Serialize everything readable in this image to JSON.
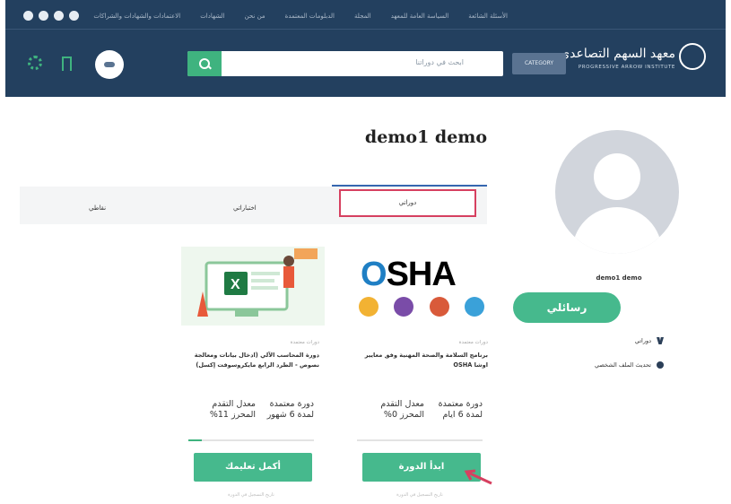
{
  "header": {
    "top_links": [
      "الأسئلة الشائعة",
      "السياسة العامة للمعهد",
      "المجلة",
      "الدبلومات المعتمدة",
      "من نحن",
      "الشهادات",
      "الاعتمادات والشهادات والشراكات"
    ],
    "logo_ar": "معهد السهم التصاعدي",
    "logo_en": "PROGRESSIVE ARROW INSTITUTE",
    "search_placeholder": "ابحث في دوراتنا",
    "category_label": "CATEGORY"
  },
  "profile": {
    "name": "demo1 demo",
    "side_name": "demo1 demo",
    "messages_button": "رسائلي",
    "side_links": [
      "دوراتي",
      "تحديث الملف الشخصي"
    ]
  },
  "tabs": {
    "courses": "دوراتي",
    "exams": "اختباراتي",
    "points": "نقاطي"
  },
  "cards": [
    {
      "thumb_type": "osha",
      "osha_text": "OSHA",
      "category": "دورات معتمدة",
      "title": "برنامج السلامة والصحة المهنية وفق معايير اوشا OSHA",
      "meta_left": "معدل التقدم المحرز 0%",
      "meta_right": "دورة معتمدة لمدة 6 ايام",
      "progress": 0,
      "action": "ابدأ الدورة",
      "date": "تاريخ التسجيل في الدورة"
    },
    {
      "thumb_type": "excel",
      "badge": "",
      "category": "دورات معتمدة",
      "title": "دورة المحاسب الآلي (ادخال بيانات ومعالجة نصوص - الطرد الرابع مايكروسوفت إكسل)",
      "meta_left": "معدل التقدم المحرز 11%",
      "meta_right": "دورة معتمدة لمدة 6 شهور",
      "progress": 11,
      "action": "أكمل تعليمك",
      "date": "تاريخ التسجيل في الدورة"
    }
  ],
  "colors": {
    "header_bg": "#23405f",
    "accent_green": "#46b98d",
    "highlight_red": "#d64060"
  }
}
